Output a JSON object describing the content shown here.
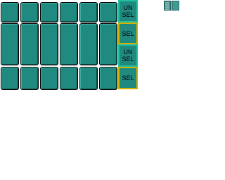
{
  "grid": {
    "rows": [
      {
        "row": 1,
        "cells": 6
      },
      {
        "row": 2,
        "cells": 6
      },
      {
        "row": 3,
        "cells": 6
      }
    ]
  },
  "controls": {
    "unselect_top_label": "UN\nSEL",
    "select_1_label": "SEL",
    "unselect_2_label": "UN\nSEL",
    "select_2_label": "SEL"
  },
  "toolbar": {
    "page_icon": "two-page-icon"
  },
  "colors": {
    "cell": "#208a80",
    "select_border": "#d4b000",
    "unselect_border": "#20c0a0"
  }
}
